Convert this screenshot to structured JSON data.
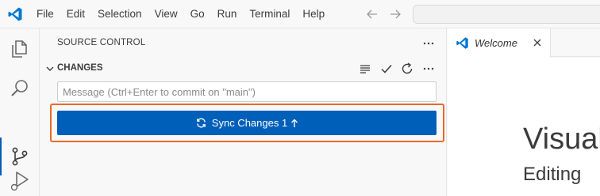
{
  "menubar": {
    "items": [
      "File",
      "Edit",
      "Selection",
      "View",
      "Go",
      "Run",
      "Terminal",
      "Help"
    ]
  },
  "sidebar": {
    "title": "SOURCE CONTROL",
    "section": {
      "title": "CHANGES"
    },
    "commit_input": {
      "placeholder": "Message (Ctrl+Enter to commit on \"main\")",
      "value": ""
    },
    "sync_button": {
      "label": "Sync Changes 1"
    }
  },
  "editor": {
    "tab_label": "Welcome",
    "welcome_title": "Visual",
    "welcome_subtitle": "Editing"
  },
  "colors": {
    "accent": "#005fb8",
    "highlight": "#e8692a",
    "logo": "#0078d4"
  },
  "icons": {
    "activity": [
      "explorer-icon",
      "search-icon",
      "source-control-icon",
      "run-debug-icon"
    ],
    "section_actions": [
      "view-as-list-icon",
      "commit-check-icon",
      "refresh-icon",
      "more-actions-icon"
    ]
  }
}
